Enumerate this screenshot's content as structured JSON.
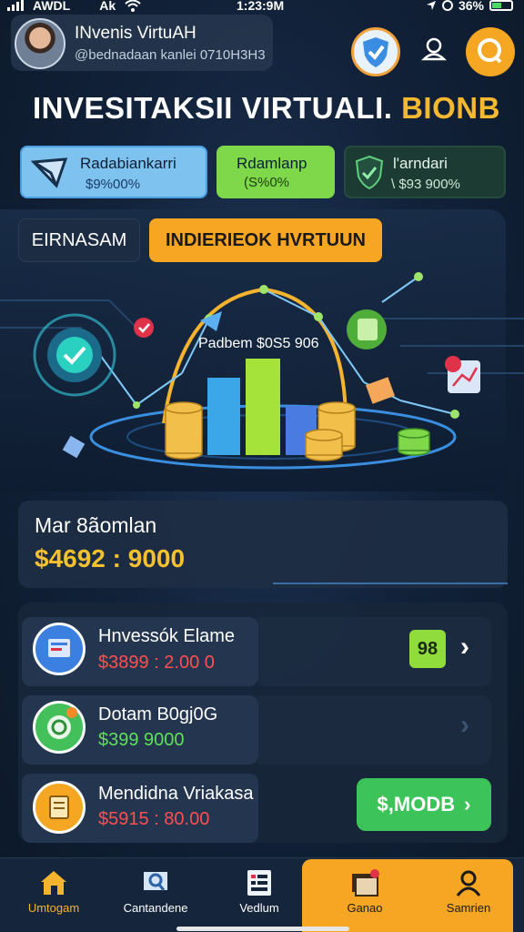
{
  "status_bar": {
    "carrier": "AWDL",
    "extra": "Ak",
    "time": "1:23:9M",
    "battery": "36%"
  },
  "profile": {
    "name": "INvenis VirtuAH",
    "subtitle": "@bednadaan kanlei 0710H3H3"
  },
  "header_icons": {
    "shield": "shield-check-icon",
    "user": "user-icon",
    "chat": "chat-icon"
  },
  "title": {
    "main": "INVESITAKSII VIRTUALI.",
    "accent": "BIONB"
  },
  "stats": [
    {
      "label": "Radabiankarri",
      "value": "$9%00%"
    },
    {
      "label": "Rdamlanp",
      "value": "(S%0%"
    },
    {
      "label": "l'arndari",
      "value": "\\ $93 900%"
    }
  ],
  "tabs": {
    "earn": "EIRNASAM",
    "invest": "INDIERIEOK HVRTUUN"
  },
  "hero": {
    "label": "Padbem $0S5 906"
  },
  "balance": {
    "label": "Mar 8ãomlan",
    "value": "$4692 : 9000"
  },
  "items": [
    {
      "title": "Hnvessók Elame",
      "amount": "$3899 : 2.00 0",
      "icon": "chart-doc-icon"
    },
    {
      "title": "Dotam B0gj0G",
      "amount": "$399 9000",
      "icon": "coin-icon"
    },
    {
      "title": "Mendidna Vriakasa",
      "amount": "$5915 : 80.00",
      "icon": "document-icon"
    }
  ],
  "badge": "98",
  "mode_button": "$,MODB",
  "nav": [
    {
      "label": "Umtogam",
      "icon": "home-icon"
    },
    {
      "label": "Cantandene",
      "icon": "search-icon"
    },
    {
      "label": "Vedlum",
      "icon": "grid-icon"
    },
    {
      "label": "Ganao",
      "icon": "cards-icon"
    },
    {
      "label": "Samrien",
      "icon": "profile-icon"
    }
  ],
  "colors": {
    "accent": "#f6a623",
    "gold": "#f6c12f",
    "green": "#3cc45a",
    "blue": "#4a9fe0"
  }
}
